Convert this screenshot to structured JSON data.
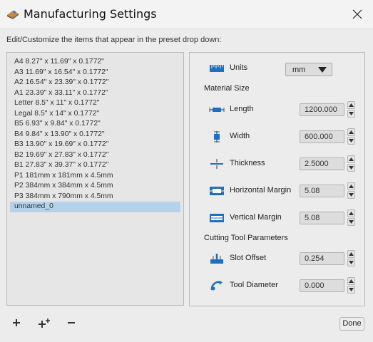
{
  "window": {
    "title": "Manufacturing Settings"
  },
  "instructions": "Edit/Customize the items that appear in the preset drop down:",
  "presets": [
    "A4 8.27\" x 11.69\" x 0.1772\"",
    "A3 11.69\" x 16.54\" x 0.1772\"",
    "A2 16.54\" x 23.39\" x 0.1772\"",
    "A1 23.39\" x 33.11\" x 0.1772\"",
    "Letter 8.5\" x 11\" x 0.1772\"",
    "Legal 8.5\" x 14\" x 0.1772\"",
    "B5 6.93\" x 9.84\" x 0.1772\"",
    "B4 9.84\" x 13.90\" x 0.1772\"",
    "B3 13.90\" x 19.69\" x 0.1772\"",
    "B2 19.69\" x 27.83\" x 0.1772\"",
    "B1 27.83\" x 39.37\" x 0.1772\"",
    "P1 181mm x 181mm x 4.5mm",
    "P2 384mm x 384mm x 4.5mm",
    "P3 384mm x 790mm x 4.5mm",
    "unnamed_0"
  ],
  "selected_preset": "unnamed_0",
  "units": {
    "label": "Units",
    "value": "mm"
  },
  "material_size": {
    "heading": "Material Size",
    "length": {
      "label": "Length",
      "value": "1200.000"
    },
    "width": {
      "label": "Width",
      "value": "600.000"
    },
    "thickness": {
      "label": "Thickness",
      "value": "2.5000"
    },
    "horizontal_margin": {
      "label": "Horizontal Margin",
      "value": "5.08"
    },
    "vertical_margin": {
      "label": "Vertical Margin",
      "value": "5.08"
    }
  },
  "cutting_tool": {
    "heading": "Cutting Tool Parameters",
    "slot_offset": {
      "label": "Slot Offset",
      "value": "0.254"
    },
    "tool_diameter": {
      "label": "Tool Diameter",
      "value": "0.000"
    }
  },
  "buttons": {
    "done": "Done"
  },
  "colors": {
    "selection": "#b5d2ea",
    "icon_blue": "#1f6fc2"
  }
}
